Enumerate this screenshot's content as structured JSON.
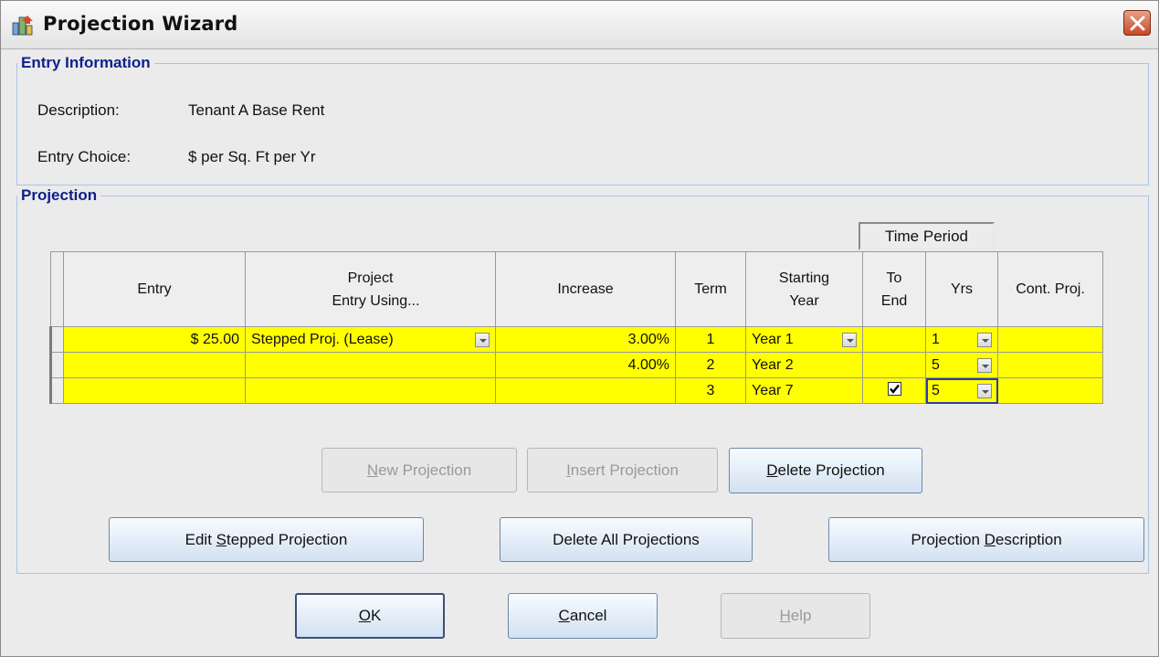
{
  "window": {
    "title": "Projection Wizard"
  },
  "entry_info": {
    "legend": "Entry Information",
    "description_label": "Description:",
    "description_value": "Tenant A Base Rent",
    "choice_label": "Entry Choice:",
    "choice_value": "$ per Sq. Ft per Yr"
  },
  "projection": {
    "legend": "Projection",
    "time_period_label": "Time Period",
    "columns": {
      "entry": "Entry",
      "project_line1": "Project",
      "project_line2": "Entry Using...",
      "increase": "Increase",
      "term": "Term",
      "start_line1": "Starting",
      "start_line2": "Year",
      "toend_line1": "To",
      "toend_line2": "End",
      "yrs": "Yrs",
      "cont": "Cont. Proj."
    },
    "rows": [
      {
        "entry": "$ 25.00",
        "method": "Stepped Proj. (Lease)",
        "increase": "3.00%",
        "term": "1",
        "start": "Year 1",
        "to_end": false,
        "yrs": "1",
        "cont": ""
      },
      {
        "entry": "",
        "method": "",
        "increase": "4.00%",
        "term": "2",
        "start": "Year 2",
        "to_end": false,
        "yrs": "5",
        "cont": ""
      },
      {
        "entry": "",
        "method": "",
        "increase": "",
        "term": "3",
        "start": "Year 7",
        "to_end": true,
        "yrs": "5",
        "cont": ""
      }
    ]
  },
  "buttons": {
    "new_projection": {
      "mnemonic": "N",
      "rest": "ew Projection"
    },
    "insert_projection": {
      "mnemonic": "I",
      "rest": "nsert Projection"
    },
    "delete_projection": {
      "mnemonic": "D",
      "rest": "elete Projection"
    },
    "edit_stepped": {
      "pre": "Edit ",
      "mnemonic": "S",
      "rest": "tepped Projection"
    },
    "delete_all": "Delete All Projections",
    "proj_description": {
      "pre": "Projection ",
      "mnemonic": "D",
      "rest": "escription"
    },
    "ok": {
      "mnemonic": "O",
      "rest": "K"
    },
    "cancel": {
      "mnemonic": "C",
      "rest": "ancel"
    },
    "help": {
      "mnemonic": "H",
      "rest": "elp"
    }
  },
  "colors": {
    "row_highlight": "#ffff00",
    "legend_text": "#0d1f8c",
    "close_button": "#c84824"
  },
  "icons": {
    "app": "building-chart-icon",
    "close": "close-icon",
    "dropdown": "chevron-down-icon",
    "check": "checkmark-icon"
  }
}
